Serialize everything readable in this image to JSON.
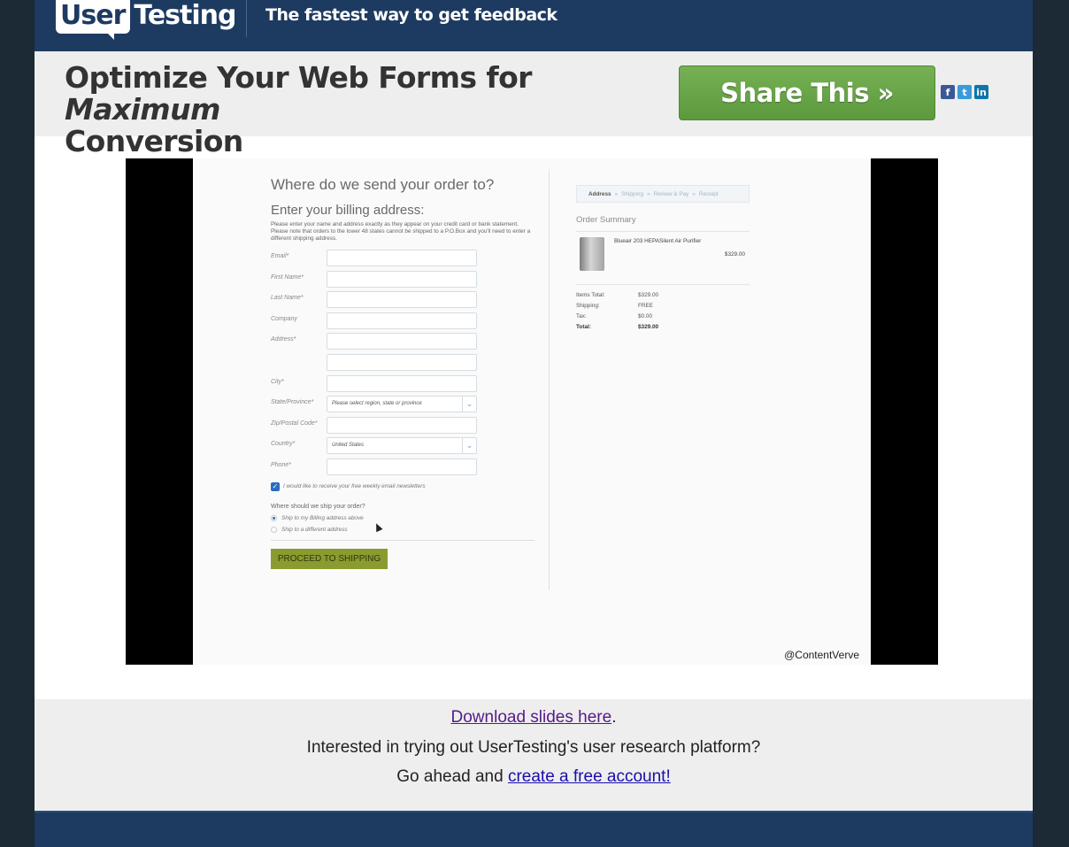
{
  "header": {
    "logo_part1": "User",
    "logo_part2": "Testing",
    "tagline": "The fastest way to get feedback"
  },
  "title_band": {
    "title_pre": "Optimize Your Web Forms for ",
    "title_em": "Maximum",
    "title_post": "Conversion",
    "share_label": "Share This »",
    "social": [
      "facebook-icon",
      "twitter-icon",
      "linkedin-icon"
    ]
  },
  "video": {
    "watermark": "@ContentVerve",
    "form": {
      "heading": "Where do we send your order to?",
      "subheading": "Enter your billing address:",
      "note": "Please enter your name and address exactly as they appear on your credit card or bank statement. Please note that orders to the lower 48 states cannot be shipped to a P.O.Box and you'll need to enter a different shipping address.",
      "fields": [
        {
          "label": "Email*",
          "kind": "input",
          "value": ""
        },
        {
          "label": "First Name*",
          "kind": "input",
          "value": ""
        },
        {
          "label": "Last Name*",
          "kind": "input",
          "value": ""
        },
        {
          "label": "Company",
          "kind": "input",
          "value": ""
        },
        {
          "label": "Address*",
          "kind": "input",
          "value": ""
        },
        {
          "label": "",
          "kind": "input",
          "value": ""
        },
        {
          "label": "City*",
          "kind": "input",
          "value": ""
        },
        {
          "label": "State/Province*",
          "kind": "select",
          "value": "Please select region, state or province"
        },
        {
          "label": "Zip/Postal Code*",
          "kind": "input",
          "value": ""
        },
        {
          "label": "Country*",
          "kind": "select",
          "value": "United States"
        },
        {
          "label": "Phone*",
          "kind": "input",
          "value": ""
        }
      ],
      "newsletter_label": "I would like to receive your free weekly email newsletters",
      "ship_question": "Where should we ship your order?",
      "ship_option_1": "Ship to my Billing address above",
      "ship_option_2": "Ship to a different address",
      "proceed_label": "PROCEED TO SHIPPING"
    },
    "summary": {
      "steps": [
        "Address",
        "Shipping",
        "Review & Pay",
        "Receipt"
      ],
      "title": "Order Summary",
      "product_name": "Blueair 203 HEPASilent Air Purifier",
      "product_price": "$329.00",
      "totals": [
        {
          "label": "Items Total:",
          "value": "$329.00"
        },
        {
          "label": "Shipping:",
          "value": "FREE"
        },
        {
          "label": "Tax:",
          "value": "$0.00"
        },
        {
          "label": "Total:",
          "value": "$329.00"
        }
      ]
    }
  },
  "info": {
    "download_link": "Download slides here",
    "download_suffix": ".",
    "question": "Interested in trying out UserTesting's user research platform?",
    "cta_prefix": "Go ahead and ",
    "cta_link": "create a free account!"
  }
}
